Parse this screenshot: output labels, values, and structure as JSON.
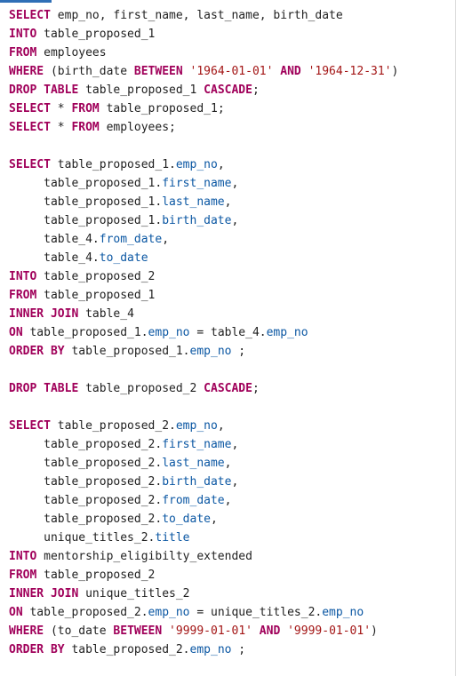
{
  "colors": {
    "keyword": "#a0005a",
    "string": "#a31515",
    "column": "#0b57a3",
    "text": "#1f1f1f",
    "accent": "#2f6fb6"
  },
  "editor": {
    "lines": [
      [
        {
          "t": "kw",
          "s": "SELECT"
        },
        {
          "t": "txt",
          "s": " emp_no, first_name, last_name, birth_date"
        }
      ],
      [
        {
          "t": "kw",
          "s": "INTO"
        },
        {
          "t": "txt",
          "s": " table_proposed_1"
        }
      ],
      [
        {
          "t": "kw",
          "s": "FROM"
        },
        {
          "t": "txt",
          "s": " employees"
        }
      ],
      [
        {
          "t": "kw",
          "s": "WHERE"
        },
        {
          "t": "txt",
          "s": " (birth_date "
        },
        {
          "t": "kw",
          "s": "BETWEEN"
        },
        {
          "t": "txt",
          "s": " "
        },
        {
          "t": "str",
          "s": "'1964-01-01'"
        },
        {
          "t": "txt",
          "s": " "
        },
        {
          "t": "kw",
          "s": "AND"
        },
        {
          "t": "txt",
          "s": " "
        },
        {
          "t": "str",
          "s": "'1964-12-31'"
        },
        {
          "t": "txt",
          "s": ")"
        }
      ],
      [
        {
          "t": "kw",
          "s": "DROP TABLE"
        },
        {
          "t": "txt",
          "s": " table_proposed_1 "
        },
        {
          "t": "kw",
          "s": "CASCADE"
        },
        {
          "t": "txt",
          "s": ";"
        }
      ],
      [
        {
          "t": "kw",
          "s": "SELECT"
        },
        {
          "t": "txt",
          "s": " * "
        },
        {
          "t": "kw",
          "s": "FROM"
        },
        {
          "t": "txt",
          "s": " table_proposed_1;"
        }
      ],
      [
        {
          "t": "kw",
          "s": "SELECT"
        },
        {
          "t": "txt",
          "s": " * "
        },
        {
          "t": "kw",
          "s": "FROM"
        },
        {
          "t": "txt",
          "s": " employees;"
        }
      ],
      [],
      [
        {
          "t": "kw",
          "s": "SELECT"
        },
        {
          "t": "txt",
          "s": " table_proposed_1."
        },
        {
          "t": "col",
          "s": "emp_no"
        },
        {
          "t": "txt",
          "s": ","
        }
      ],
      [
        {
          "t": "txt",
          "s": "     table_proposed_1."
        },
        {
          "t": "col",
          "s": "first_name"
        },
        {
          "t": "txt",
          "s": ","
        }
      ],
      [
        {
          "t": "txt",
          "s": "     table_proposed_1."
        },
        {
          "t": "col",
          "s": "last_name"
        },
        {
          "t": "txt",
          "s": ","
        }
      ],
      [
        {
          "t": "txt",
          "s": "     table_proposed_1."
        },
        {
          "t": "col",
          "s": "birth_date"
        },
        {
          "t": "txt",
          "s": ","
        }
      ],
      [
        {
          "t": "txt",
          "s": "     table_4."
        },
        {
          "t": "col",
          "s": "from_date"
        },
        {
          "t": "txt",
          "s": ","
        }
      ],
      [
        {
          "t": "txt",
          "s": "     table_4."
        },
        {
          "t": "col",
          "s": "to_date"
        }
      ],
      [
        {
          "t": "kw",
          "s": "INTO"
        },
        {
          "t": "txt",
          "s": " table_proposed_2"
        }
      ],
      [
        {
          "t": "kw",
          "s": "FROM"
        },
        {
          "t": "txt",
          "s": " table_proposed_1"
        }
      ],
      [
        {
          "t": "kw",
          "s": "INNER JOIN"
        },
        {
          "t": "txt",
          "s": " table_4"
        }
      ],
      [
        {
          "t": "kw",
          "s": "ON"
        },
        {
          "t": "txt",
          "s": " table_proposed_1."
        },
        {
          "t": "col",
          "s": "emp_no"
        },
        {
          "t": "txt",
          "s": " = table_4."
        },
        {
          "t": "col",
          "s": "emp_no"
        }
      ],
      [
        {
          "t": "kw",
          "s": "ORDER BY"
        },
        {
          "t": "txt",
          "s": " table_proposed_1."
        },
        {
          "t": "col",
          "s": "emp_no"
        },
        {
          "t": "txt",
          "s": " ;"
        }
      ],
      [],
      [
        {
          "t": "kw",
          "s": "DROP TABLE"
        },
        {
          "t": "txt",
          "s": " table_proposed_2 "
        },
        {
          "t": "kw",
          "s": "CASCADE"
        },
        {
          "t": "txt",
          "s": ";"
        }
      ],
      [],
      [
        {
          "t": "kw",
          "s": "SELECT"
        },
        {
          "t": "txt",
          "s": " table_proposed_2."
        },
        {
          "t": "col",
          "s": "emp_no"
        },
        {
          "t": "txt",
          "s": ","
        }
      ],
      [
        {
          "t": "txt",
          "s": "     table_proposed_2."
        },
        {
          "t": "col",
          "s": "first_name"
        },
        {
          "t": "txt",
          "s": ","
        }
      ],
      [
        {
          "t": "txt",
          "s": "     table_proposed_2."
        },
        {
          "t": "col",
          "s": "last_name"
        },
        {
          "t": "txt",
          "s": ","
        }
      ],
      [
        {
          "t": "txt",
          "s": "     table_proposed_2."
        },
        {
          "t": "col",
          "s": "birth_date"
        },
        {
          "t": "txt",
          "s": ","
        }
      ],
      [
        {
          "t": "txt",
          "s": "     table_proposed_2."
        },
        {
          "t": "col",
          "s": "from_date"
        },
        {
          "t": "txt",
          "s": ","
        }
      ],
      [
        {
          "t": "txt",
          "s": "     table_proposed_2."
        },
        {
          "t": "col",
          "s": "to_date"
        },
        {
          "t": "txt",
          "s": ","
        }
      ],
      [
        {
          "t": "txt",
          "s": "     unique_titles_2."
        },
        {
          "t": "col",
          "s": "title"
        }
      ],
      [
        {
          "t": "kw",
          "s": "INTO"
        },
        {
          "t": "txt",
          "s": " mentorship_eligibilty_extended"
        }
      ],
      [
        {
          "t": "kw",
          "s": "FROM"
        },
        {
          "t": "txt",
          "s": " table_proposed_2"
        }
      ],
      [
        {
          "t": "kw",
          "s": "INNER JOIN"
        },
        {
          "t": "txt",
          "s": " unique_titles_2"
        }
      ],
      [
        {
          "t": "kw",
          "s": "ON"
        },
        {
          "t": "txt",
          "s": " table_proposed_2."
        },
        {
          "t": "col",
          "s": "emp_no"
        },
        {
          "t": "txt",
          "s": " = unique_titles_2."
        },
        {
          "t": "col",
          "s": "emp_no"
        }
      ],
      [
        {
          "t": "kw",
          "s": "WHERE"
        },
        {
          "t": "txt",
          "s": " (to_date "
        },
        {
          "t": "kw",
          "s": "BETWEEN"
        },
        {
          "t": "txt",
          "s": " "
        },
        {
          "t": "str",
          "s": "'9999-01-01'"
        },
        {
          "t": "txt",
          "s": " "
        },
        {
          "t": "kw",
          "s": "AND"
        },
        {
          "t": "txt",
          "s": " "
        },
        {
          "t": "str",
          "s": "'9999-01-01'"
        },
        {
          "t": "txt",
          "s": ")"
        }
      ],
      [
        {
          "t": "kw",
          "s": "ORDER BY"
        },
        {
          "t": "txt",
          "s": " table_proposed_2."
        },
        {
          "t": "col",
          "s": "emp_no"
        },
        {
          "t": "txt",
          "s": " ;"
        }
      ]
    ]
  }
}
